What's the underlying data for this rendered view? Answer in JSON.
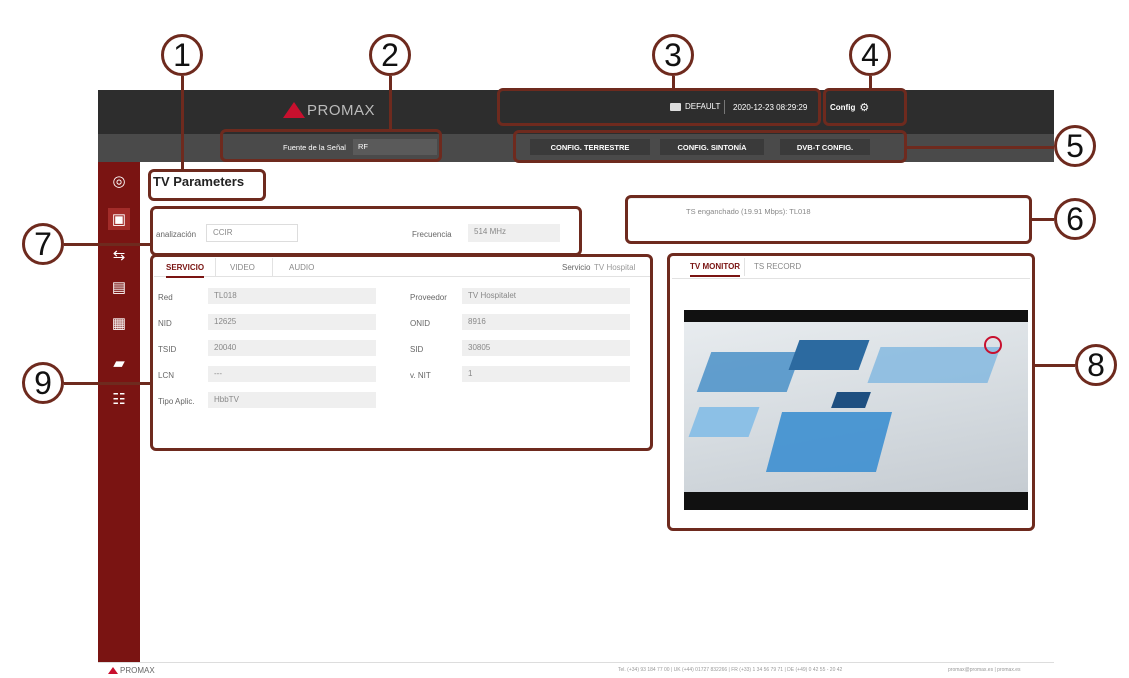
{
  "header": {
    "brand": "PROMAX",
    "profile": "DEFAULT",
    "datetime": "2020-12-23 08:29:29",
    "config_label": "Config"
  },
  "subheader": {
    "source_label": "Fuente de la Señal",
    "source_value": "RF",
    "buttons": [
      "CONFIG. TERRESTRE",
      "CONFIG. SINTONÍA",
      "DVB-T CONFIG."
    ]
  },
  "page": {
    "title": "TV Parameters"
  },
  "tuning": {
    "channel_label": "analización",
    "channel_value": "CCIR",
    "freq_label": "Frecuencia",
    "freq_value": "514 MHz"
  },
  "ts_status": "TS enganchado (19.91 Mbps): TL018",
  "service": {
    "tabs": [
      "SERVICIO",
      "VIDEO",
      "AUDIO"
    ],
    "service_label": "Servicio",
    "service_value": "TV Hospital",
    "left_labels": [
      "Red",
      "NID",
      "TSID",
      "LCN",
      "Tipo Aplic."
    ],
    "left_values": [
      "TL018",
      "12625",
      "20040",
      "---",
      "HbbTV"
    ],
    "right_labels": [
      "Proveedor",
      "ONID",
      "SID",
      "v. NIT"
    ],
    "right_values": [
      "TV Hospitalet",
      "8916",
      "30805",
      "1"
    ]
  },
  "monitor": {
    "tabs": [
      "TV MONITOR",
      "TS RECORD"
    ]
  },
  "callouts": [
    "1",
    "2",
    "3",
    "4",
    "5",
    "6",
    "7",
    "8",
    "9"
  ],
  "footer": {
    "brand": "PROMAX",
    "contacts": "Tel. (+34) 93 184 77 00  |  UK (+44) 01727 832266  |  FR (+33) 1 34 56 79 71  |  DE (+49) 0 42 55 - 20 42",
    "email": "promax@promax.es  |  promax.es"
  },
  "colors": {
    "brand_red": "#c8102e",
    "sidebar": "#7a1412",
    "callout": "#6e2a1e",
    "topbar": "#2d2d2d"
  }
}
